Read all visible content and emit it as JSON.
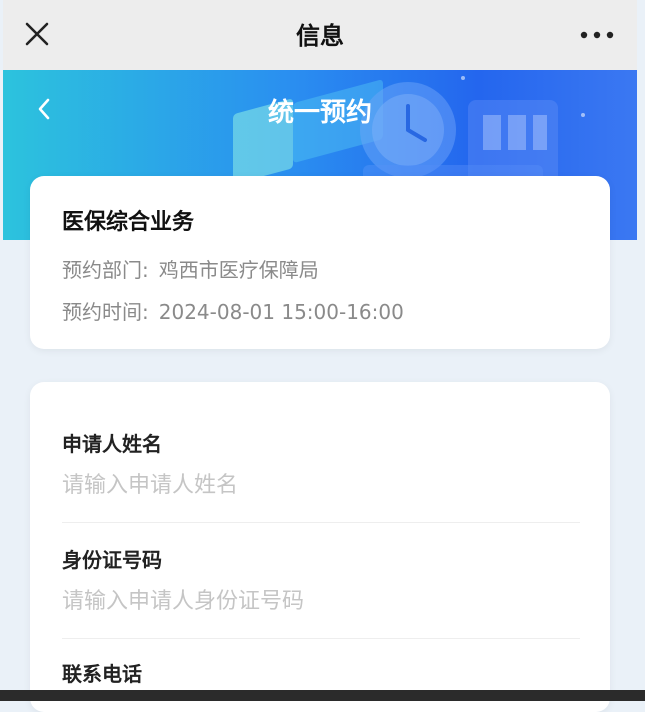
{
  "topbar": {
    "title": "信息",
    "close_icon": "close-icon",
    "more_icon": "more-dots-icon"
  },
  "banner": {
    "title": "统一预约",
    "back_icon": "chevron-left-icon",
    "gradient_start": "#2cc3dd",
    "gradient_end": "#2466ee"
  },
  "appointment": {
    "service": "医保综合业务",
    "dept_label": "预约部门:",
    "dept_value": "鸡西市医疗保障局",
    "time_label": "预约时间:",
    "time_value": "2024-08-01 15:00-16:00"
  },
  "form": {
    "name_label": "申请人姓名",
    "name_placeholder": "请输入申请人姓名",
    "id_label": "身份证号码",
    "id_placeholder": "请输入申请人身份证号码",
    "phone_label": "联系电话"
  }
}
